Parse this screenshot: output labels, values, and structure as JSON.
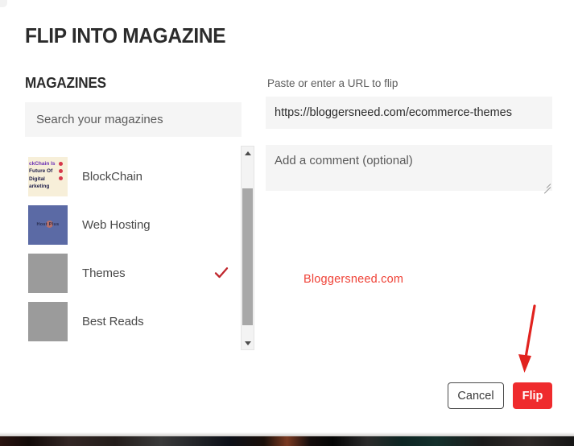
{
  "dialog": {
    "title": "FLIP INTO MAGAZINE"
  },
  "left_panel": {
    "section_label": "MAGAZINES",
    "search": {
      "placeholder": "Search your magazines",
      "value": ""
    },
    "magazines": [
      {
        "name": "",
        "thumb_kind": "partial-cutoff",
        "selected": false
      },
      {
        "name": "BlockChain",
        "thumb_kind": "blockchain-cover",
        "cover_line1": "ckChain Is",
        "cover_line2": "Future Of",
        "cover_line3": "Digital",
        "cover_line4": "arketing",
        "selected": false
      },
      {
        "name": "Web Hosting",
        "thumb_kind": "hosting-cover",
        "cover_text": "Host    Plus",
        "selected": false
      },
      {
        "name": "Themes",
        "thumb_kind": "plain-gray",
        "selected": true
      },
      {
        "name": "Best Reads",
        "thumb_kind": "plain-gray",
        "selected": false
      }
    ],
    "scrollbar": {
      "up_arrow": "scroll-up",
      "down_arrow": "scroll-down"
    }
  },
  "right_panel": {
    "url_label": "Paste or enter a URL to flip",
    "url_input": {
      "value": "https://bloggersneed.com/ecommerce-themes",
      "placeholder": "Paste or enter a URL to flip"
    },
    "comment": {
      "placeholder": "Add a comment (optional)",
      "value": ""
    },
    "watermark": "Bloggersneed.com"
  },
  "footer": {
    "cancel_label": "Cancel",
    "flip_label": "Flip"
  },
  "colors": {
    "accent_red": "#ef2b2d",
    "watermark_red": "#ef4136",
    "check_red": "#c0272d",
    "arrow_red": "#e1231f",
    "field_bg": "#f5f5f5",
    "thumb_gray": "#9b9b9b"
  },
  "annotations": {
    "arrow": "red-down-arrow-pointing-to-flip-button"
  }
}
